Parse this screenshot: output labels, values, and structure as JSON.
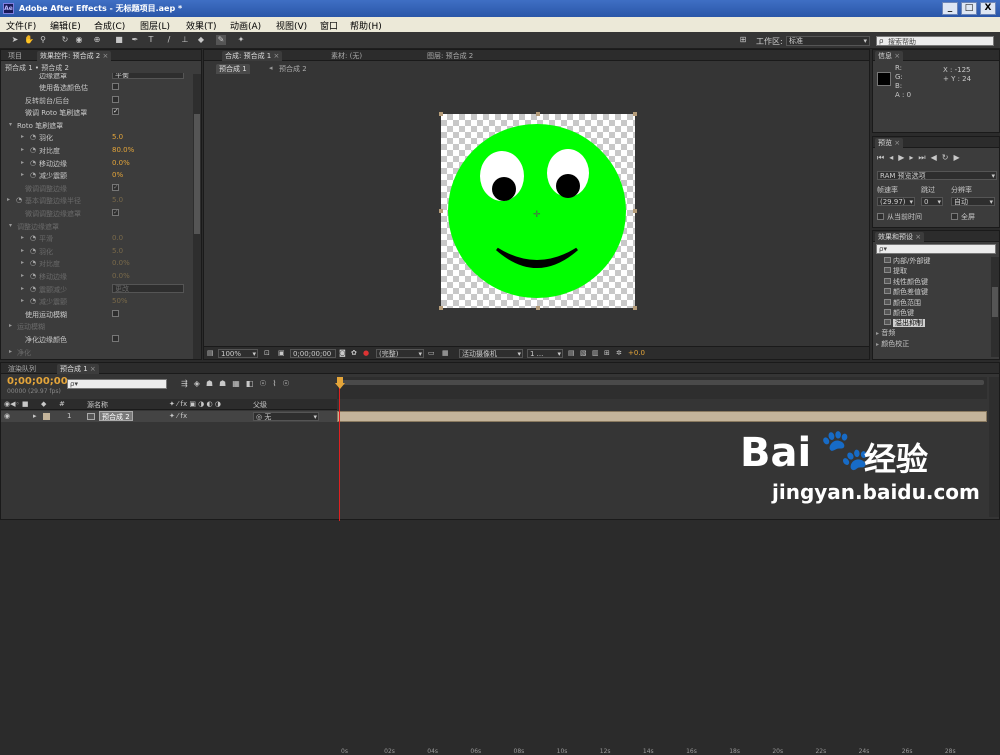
{
  "window": {
    "app_logo": "Ae",
    "title": "Adobe After Effects - 无标题项目.aep *",
    "buttons": [
      "_",
      "□",
      "X"
    ]
  },
  "menu": [
    "文件(F)",
    "编辑(E)",
    "合成(C)",
    "图层(L)",
    "效果(T)",
    "动画(A)",
    "视图(V)",
    "窗口",
    "帮助(H)"
  ],
  "toolbar": {
    "workspace_label": "工作区:",
    "workspace_value": "标准",
    "search_placeholder": "搜索帮助"
  },
  "effects_panel": {
    "tabs": [
      "项目",
      "效果控件: 预合成 2"
    ],
    "breadcrumb": "预合成 1 • 预合成 2",
    "clipped_row": {
      "label": "边缘遮罩",
      "value": "平衡"
    },
    "rows": [
      {
        "label": "使用备选颜色估",
        "type": "checkbox",
        "checked": false
      },
      {
        "label": "反转前台/后台",
        "type": "checkbox",
        "checked": false
      },
      {
        "label": "微调 Roto 笔刷遮罩",
        "type": "checkbox",
        "checked": true
      },
      {
        "label": "Roto 笔刷遮罩",
        "type": "group"
      },
      {
        "label": "羽化",
        "value": "5.0"
      },
      {
        "label": "对比度",
        "value": "80.0%"
      },
      {
        "label": "移动边缘",
        "value": "0.0%"
      },
      {
        "label": "减少震颤",
        "value": "0%"
      },
      {
        "label": "微调调整边缘",
        "type": "checkbox",
        "checked": true,
        "dim": true
      },
      {
        "label": "基本调整边缘半径",
        "value": "5.0",
        "dim": true
      },
      {
        "label": "微调调整边缘遮罩",
        "type": "checkbox",
        "checked": true,
        "dim": true
      },
      {
        "label": "调整边缘遮罩",
        "type": "group",
        "dim": true
      },
      {
        "label": "平滑",
        "value": "0.0",
        "dim": true
      },
      {
        "label": "羽化",
        "value": "5.0",
        "dim": true
      },
      {
        "label": "对比度",
        "value": "0.0%",
        "dim": true
      },
      {
        "label": "移动边缘",
        "value": "0.0%",
        "dim": true
      },
      {
        "label": "震颤减少",
        "value": "更改",
        "dim": true
      },
      {
        "label": "减少震颤",
        "value": "50%",
        "dim": true
      },
      {
        "label": "使用运动模糊",
        "type": "checkbox",
        "checked": false
      },
      {
        "label": "运动模糊",
        "type": "group",
        "dim": true
      },
      {
        "label": "净化边缘颜色",
        "type": "checkbox",
        "checked": false
      },
      {
        "label": "净化",
        "type": "group",
        "dim": true
      }
    ]
  },
  "composition_panel": {
    "tabs": [
      "合成: 预合成 1",
      "素材: (无)",
      "图层: 预合成 2"
    ],
    "subtabs": [
      "预合成 1",
      "预合成 2"
    ],
    "bottom": {
      "zoom": "100%",
      "time": "0;00;00;00",
      "resolution": "(完整)",
      "camera": "活动摄像机",
      "views": "1 ...",
      "exposure": "+0.0"
    }
  },
  "info_panel": {
    "tab": "信息",
    "r": "R:",
    "g": "G:",
    "b": "B:",
    "a": "A : 0",
    "x": "X : -125",
    "y": "+ Y : 24"
  },
  "preview_panel": {
    "tab": "预览",
    "ram_options": "RAM 预览选项",
    "frame_rate_label": "帧速率",
    "skip_label": "跳过",
    "resolution_label": "分辨率",
    "frame_rate": "(29.97)",
    "skip": "0",
    "resolution": "自动",
    "from_current": "从当前时间",
    "fullscreen": "全屏"
  },
  "effects_presets": {
    "tab": "效果和预设",
    "search_placeholder": "ρ▾",
    "items": [
      "内部/外部键",
      "提取",
      "线性颜色键",
      "颜色差值键",
      "颜色范围",
      "颜色键",
      "溢出抑制"
    ],
    "selected_index": 6,
    "groups": [
      "音频",
      "颜色校正"
    ]
  },
  "timeline": {
    "tabs": [
      "渲染队列",
      "预合成 1"
    ],
    "timecode": "0;00;00;00",
    "timecode_sub": "00000 (29.97 fps)",
    "search_placeholder": "ρ▾",
    "columns": {
      "name": "源名称",
      "parent": "父级"
    },
    "layer": {
      "index": "1",
      "name": "预合成 2",
      "parent": "无"
    },
    "ticks": [
      "0s",
      "02s",
      "04s",
      "06s",
      "08s",
      "10s",
      "12s",
      "14s",
      "16s",
      "18s",
      "20s",
      "22s",
      "24s",
      "26s",
      "28s"
    ]
  },
  "watermark": {
    "brand": "Bai",
    "brand2": "经验",
    "url": "jingyan.baidu.com"
  },
  "colors": {
    "face": "#00ff00",
    "accent_value": "#e4a53a",
    "layer_bar": "#c4b49a",
    "playhead": "#e02020"
  }
}
